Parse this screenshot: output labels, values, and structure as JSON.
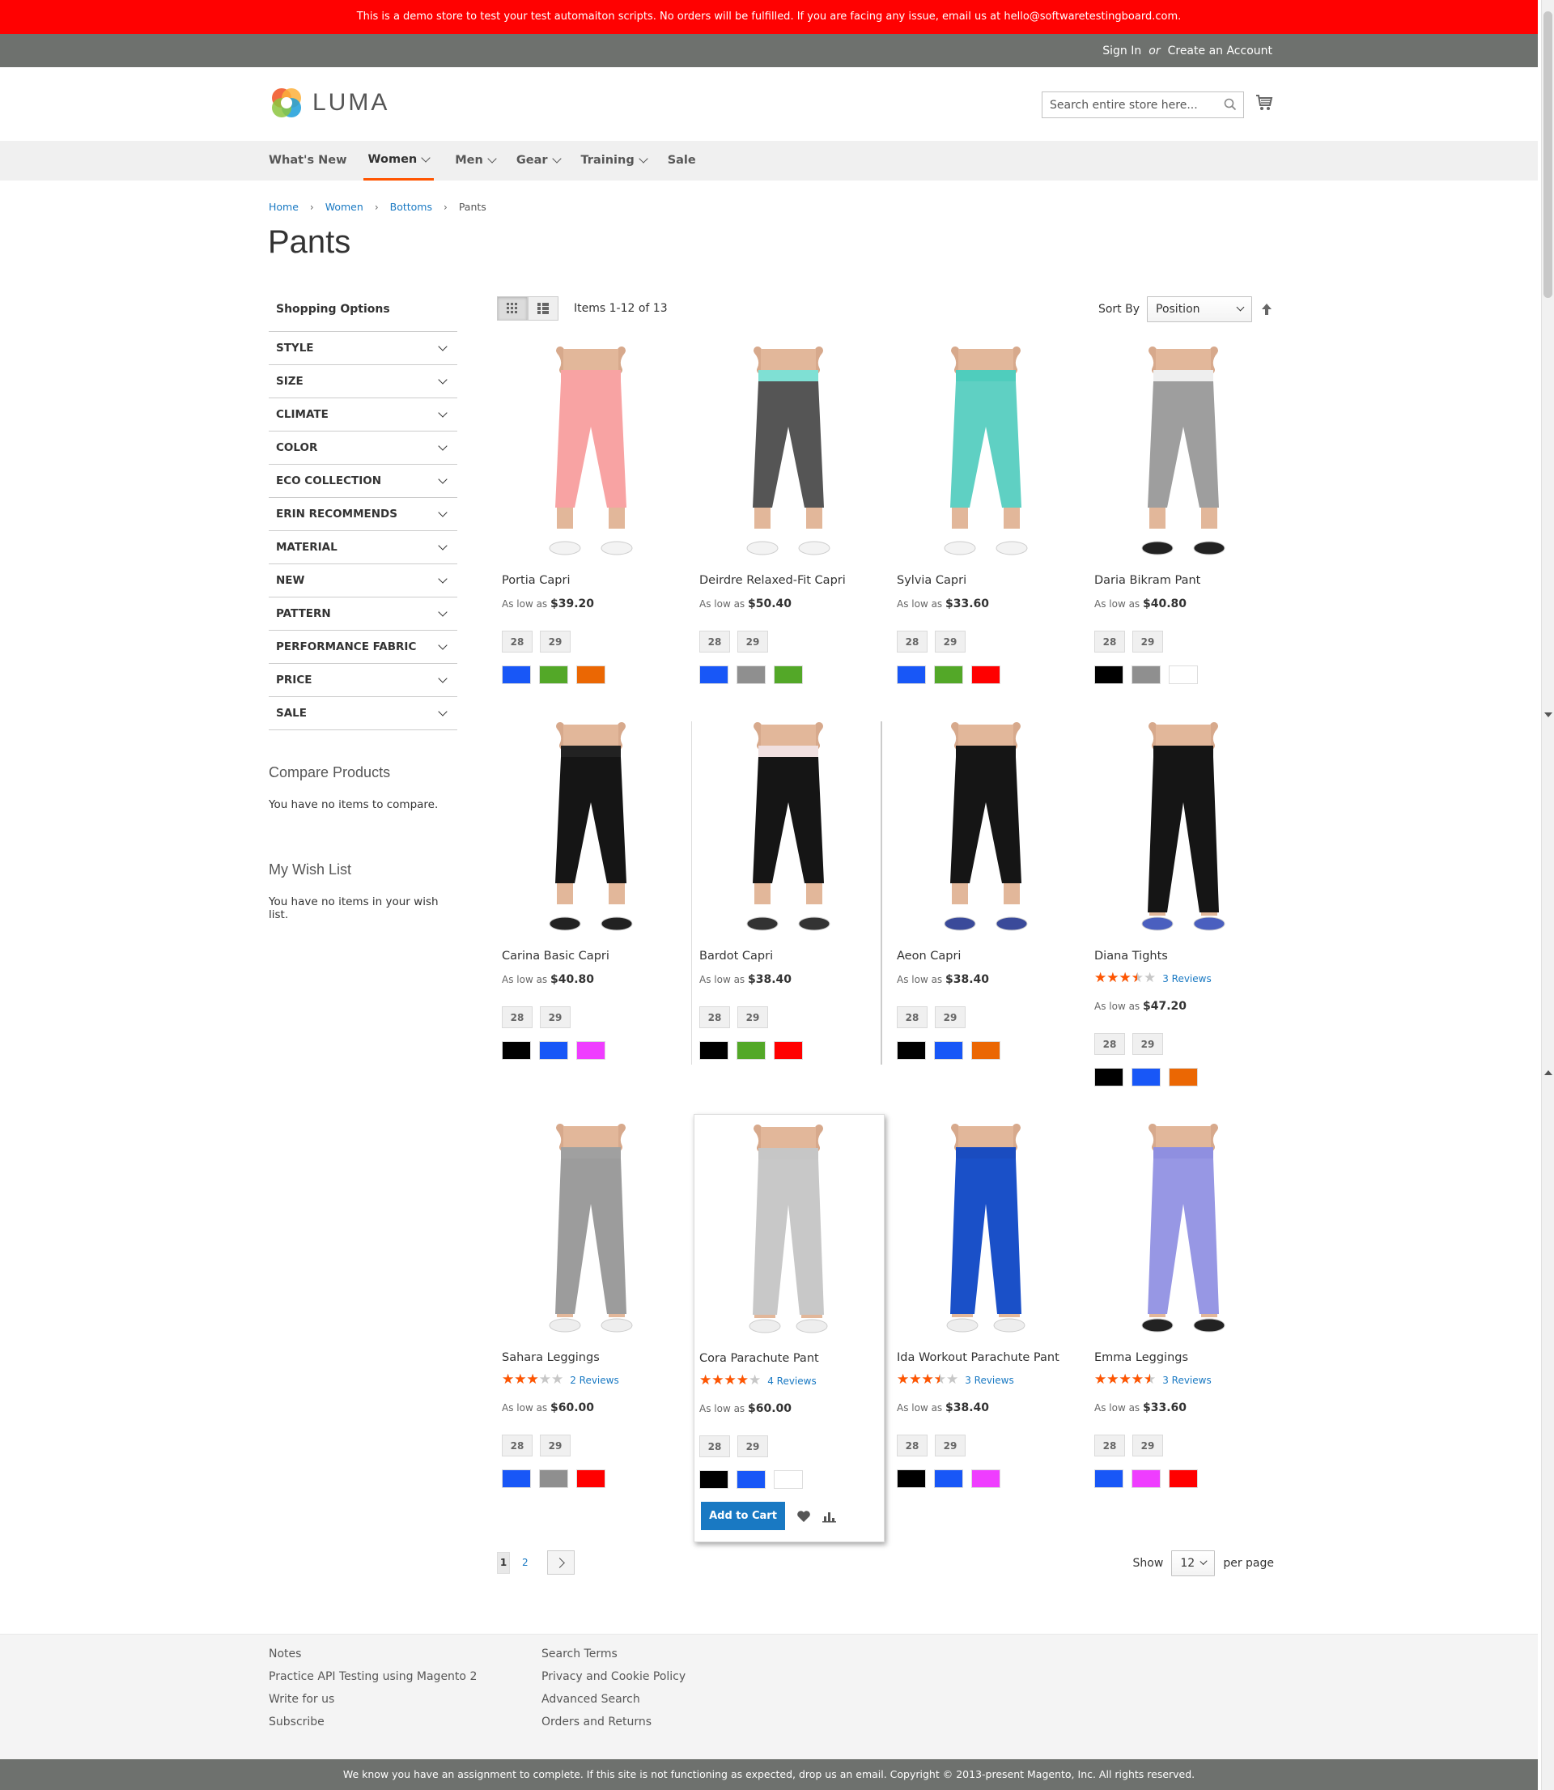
{
  "demo_notice": "This is a demo store to test your test automaiton scripts. No orders will be fulfilled. If you are facing any issue, email us at hello@softwaretestingboard.com.",
  "top_links": {
    "sign_in": "Sign In",
    "or": "or",
    "create_account": "Create an Account"
  },
  "logo": {
    "text": "LUMA"
  },
  "search": {
    "placeholder": "Search entire store here..."
  },
  "nav": {
    "items": [
      {
        "label": "What's New"
      },
      {
        "label": "Women"
      },
      {
        "label": "Men"
      },
      {
        "label": "Gear"
      },
      {
        "label": "Training"
      },
      {
        "label": "Sale"
      }
    ]
  },
  "breadcrumb": {
    "home": "Home",
    "women": "Women",
    "bottoms": "Bottoms",
    "current": "Pants"
  },
  "page_title": "Pants",
  "sidebar": {
    "title": "Shopping Options",
    "filters": [
      "STYLE",
      "SIZE",
      "CLIMATE",
      "COLOR",
      "ECO COLLECTION",
      "ERIN RECOMMENDS",
      "MATERIAL",
      "NEW",
      "PATTERN",
      "PERFORMANCE FABRIC",
      "PRICE",
      "SALE"
    ],
    "compare_title": "Compare Products",
    "compare_text": "You have no items to compare.",
    "wishlist_title": "My Wish List",
    "wishlist_text": "You have no items in your wish list."
  },
  "toolbar": {
    "amount": "Items 1-12 of 13",
    "sort_label": "Sort By",
    "sort_value": "Position"
  },
  "price_prefix": "As low as",
  "products": [
    {
      "name": "Portia Capri",
      "price": "$39.20",
      "sizes": [
        "28",
        "29"
      ],
      "swatches": [
        "#1857f7",
        "#53a828",
        "#eb6703"
      ],
      "rating": null,
      "reviews": null,
      "top": "#f8a3a3",
      "pants": "#f8a3a3",
      "cuff": "#f3f3f3",
      "style": "capri",
      "shoes": "#f3f3f3"
    },
    {
      "name": "Deirdre Relaxed-Fit Capri",
      "price": "$50.40",
      "sizes": [
        "28",
        "29"
      ],
      "swatches": [
        "#1857f7",
        "#8f8f8f",
        "#53a828"
      ],
      "rating": null,
      "reviews": null,
      "top": "#7fe0d4",
      "pants": "#555555",
      "cuff": "#555555",
      "style": "capri",
      "shoes": "#f3f3f3"
    },
    {
      "name": "Sylvia Capri",
      "price": "$33.60",
      "sizes": [
        "28",
        "29"
      ],
      "swatches": [
        "#1857f7",
        "#53a828",
        "#ff0000"
      ],
      "rating": null,
      "reviews": null,
      "top": "#4fcdbd",
      "pants": "#5fd0c3",
      "cuff": "#5fd0c3",
      "style": "capri",
      "shoes": "#f3f3f3"
    },
    {
      "name": "Daria Bikram Pant",
      "price": "$40.80",
      "sizes": [
        "28",
        "29"
      ],
      "swatches": [
        "#000000",
        "#8f8f8f",
        "#ffffff"
      ],
      "rating": null,
      "reviews": null,
      "top": "#eeeeee",
      "pants": "#9e9e9e",
      "cuff": "#9e9e9e",
      "style": "capri",
      "shoes": "#222222"
    },
    {
      "name": "Carina Basic Capri",
      "price": "$40.80",
      "sizes": [
        "28",
        "29"
      ],
      "swatches": [
        "#000000",
        "#1857f7",
        "#ef3dff"
      ],
      "rating": null,
      "reviews": null,
      "top": "#222222",
      "pants": "#151515",
      "cuff": "#151515",
      "style": "capri",
      "shoes": "#222222"
    },
    {
      "name": "Bardot Capri",
      "price": "$38.40",
      "sizes": [
        "28",
        "29"
      ],
      "swatches": [
        "#000000",
        "#53a828",
        "#ff0000"
      ],
      "rating": null,
      "reviews": null,
      "top": "#f0e0e0",
      "pants": "#151515",
      "cuff": "#151515",
      "style": "capri",
      "shoes": "#333333"
    },
    {
      "name": "Aeon Capri",
      "price": "$38.40",
      "sizes": [
        "28",
        "29"
      ],
      "swatches": [
        "#000000",
        "#1857f7",
        "#eb6703"
      ],
      "rating": null,
      "reviews": null,
      "top": "#151515",
      "pants": "#151515",
      "cuff": "#151515",
      "style": "capri",
      "shoes": "#3a4a9a"
    },
    {
      "name": "Diana Tights",
      "price": "$47.20",
      "sizes": [
        "28",
        "29"
      ],
      "swatches": [
        "#000000",
        "#1857f7",
        "#eb6703"
      ],
      "rating": 3.5,
      "reviews": "3 Reviews",
      "top": "#151515",
      "pants": "#151515",
      "cuff": "#151515",
      "style": "full",
      "shoes": "#4a5fbf"
    },
    {
      "name": "Sahara Leggings",
      "price": "$60.00",
      "sizes": [
        "28",
        "29"
      ],
      "swatches": [
        "#1857f7",
        "#8f8f8f",
        "#ff0000"
      ],
      "rating": 3,
      "reviews": "2 Reviews",
      "top": "#a0a0a0",
      "pants": "#9c9c9c",
      "cuff": "#9c9c9c",
      "style": "full",
      "shoes": "#eeeeee"
    },
    {
      "name": "Cora Parachute Pant",
      "price": "$60.00",
      "sizes": [
        "28",
        "29"
      ],
      "swatches": [
        "#000000",
        "#1857f7",
        "#ffffff"
      ],
      "rating": 4,
      "reviews": "4 Reviews",
      "top": "#c6c6c6",
      "pants": "#c8c8c8",
      "cuff": "#c8c8c8",
      "style": "loose",
      "shoes": "#eeeeee"
    },
    {
      "name": "Ida Workout Parachute Pant",
      "price": "$38.40",
      "sizes": [
        "28",
        "29"
      ],
      "swatches": [
        "#000000",
        "#1857f7",
        "#ef3dff"
      ],
      "rating": 3.5,
      "reviews": "3 Reviews",
      "top": "#1a4cc0",
      "pants": "#1a50c8",
      "cuff": "#1a50c8",
      "style": "loose",
      "shoes": "#eeeeee"
    },
    {
      "name": "Emma Leggings",
      "price": "$33.60",
      "sizes": [
        "28",
        "29"
      ],
      "swatches": [
        "#1857f7",
        "#ef3dff",
        "#ff0000"
      ],
      "rating": 4.5,
      "reviews": "3 Reviews",
      "top": "#8f8fe0",
      "pants": "#9797e4",
      "cuff": "#9797e4",
      "style": "full",
      "shoes": "#222222"
    }
  ],
  "add_to_cart": "Add to Cart",
  "pager": {
    "current": "1",
    "next_page": "2"
  },
  "limiter": {
    "show": "Show",
    "value": "12",
    "per_page": "per page"
  },
  "footer": {
    "col1": [
      "Notes",
      "Practice API Testing using Magento 2",
      "Write for us",
      "Subscribe"
    ],
    "col2": [
      "Search Terms",
      "Privacy and Cookie Policy",
      "Advanced Search",
      "Orders and Returns"
    ]
  },
  "copyright": "We know you have an assignment to complete. If this site is not functioning as expected, drop us an email. Copyright © 2013-present Magento, Inc. All rights reserved.",
  "colors": {
    "accent": "#ff5501",
    "link": "#1979c3",
    "demo_bar": "#ff0101"
  }
}
